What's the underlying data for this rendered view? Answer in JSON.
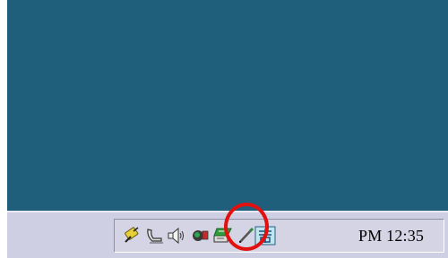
{
  "taskbar": {
    "tray_icons": [
      "usb-plug-icon",
      "telephone-modem-icon",
      "speaker-volume-icon",
      "network-globe-icon",
      "network-connection-icon",
      "pen-input-icon",
      "input-method-icon"
    ],
    "clock_text": "PM 12:35"
  },
  "colors": {
    "desktop": "#205f7c",
    "taskbar": "#cfcfe4",
    "highlight": "#e31010"
  }
}
